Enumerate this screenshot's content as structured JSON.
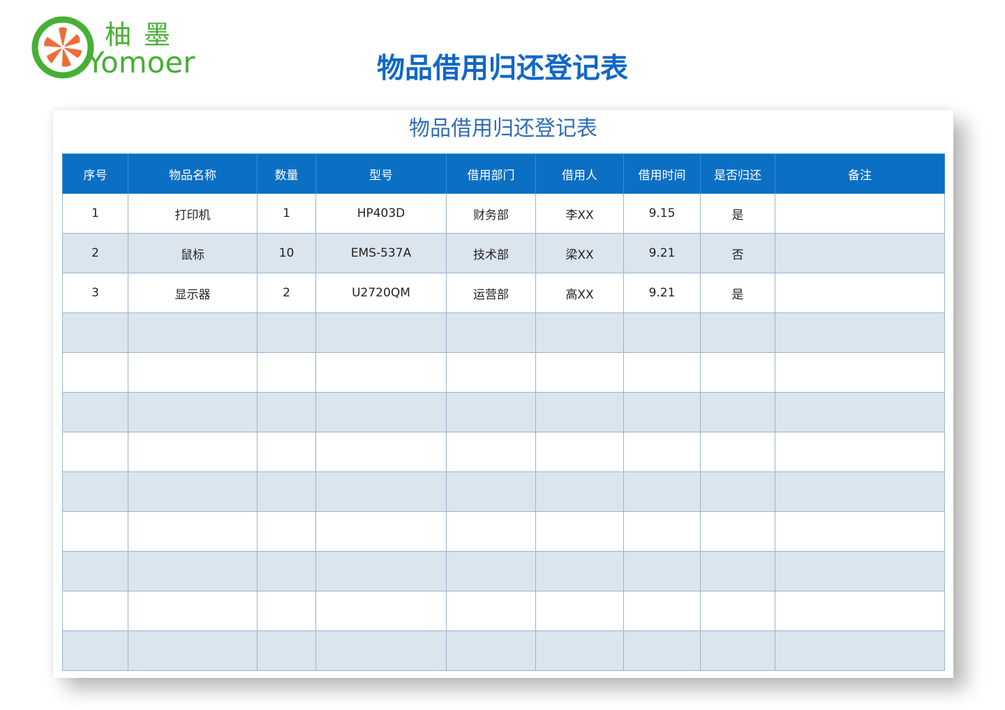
{
  "logo": {
    "cn_text": "柚墨",
    "en_text": "Yomoer"
  },
  "title": "物品借用归还登记表",
  "sheet": {
    "title": "物品借用归还登记表",
    "columns": [
      "序号",
      "物品名称",
      "数量",
      "型号",
      "借用部门",
      "借用人",
      "借用时间",
      "是否归还",
      "备注"
    ],
    "rows": [
      [
        "1",
        "打印机",
        "1",
        "HP403D",
        "财务部",
        "李XX",
        "9.15",
        "是",
        ""
      ],
      [
        "2",
        "鼠标",
        "10",
        "EMS-537A",
        "技术部",
        "梁XX",
        "9.21",
        "否",
        ""
      ],
      [
        "3",
        "显示器",
        "2",
        "U2720QM",
        "运营部",
        "高XX",
        "9.21",
        "是",
        ""
      ],
      [
        "",
        "",
        "",
        "",
        "",
        "",
        "",
        "",
        ""
      ],
      [
        "",
        "",
        "",
        "",
        "",
        "",
        "",
        "",
        ""
      ],
      [
        "",
        "",
        "",
        "",
        "",
        "",
        "",
        "",
        ""
      ],
      [
        "",
        "",
        "",
        "",
        "",
        "",
        "",
        "",
        ""
      ],
      [
        "",
        "",
        "",
        "",
        "",
        "",
        "",
        "",
        ""
      ],
      [
        "",
        "",
        "",
        "",
        "",
        "",
        "",
        "",
        ""
      ],
      [
        "",
        "",
        "",
        "",
        "",
        "",
        "",
        "",
        ""
      ],
      [
        "",
        "",
        "",
        "",
        "",
        "",
        "",
        "",
        ""
      ],
      [
        "",
        "",
        "",
        "",
        "",
        "",
        "",
        "",
        ""
      ]
    ]
  },
  "colors": {
    "header_bg": "#0b6fc4",
    "title_blue": "#1067c7",
    "band_row": "#dbe5ee",
    "logo_green": "#46b035",
    "logo_orange": "#f26b3a"
  }
}
